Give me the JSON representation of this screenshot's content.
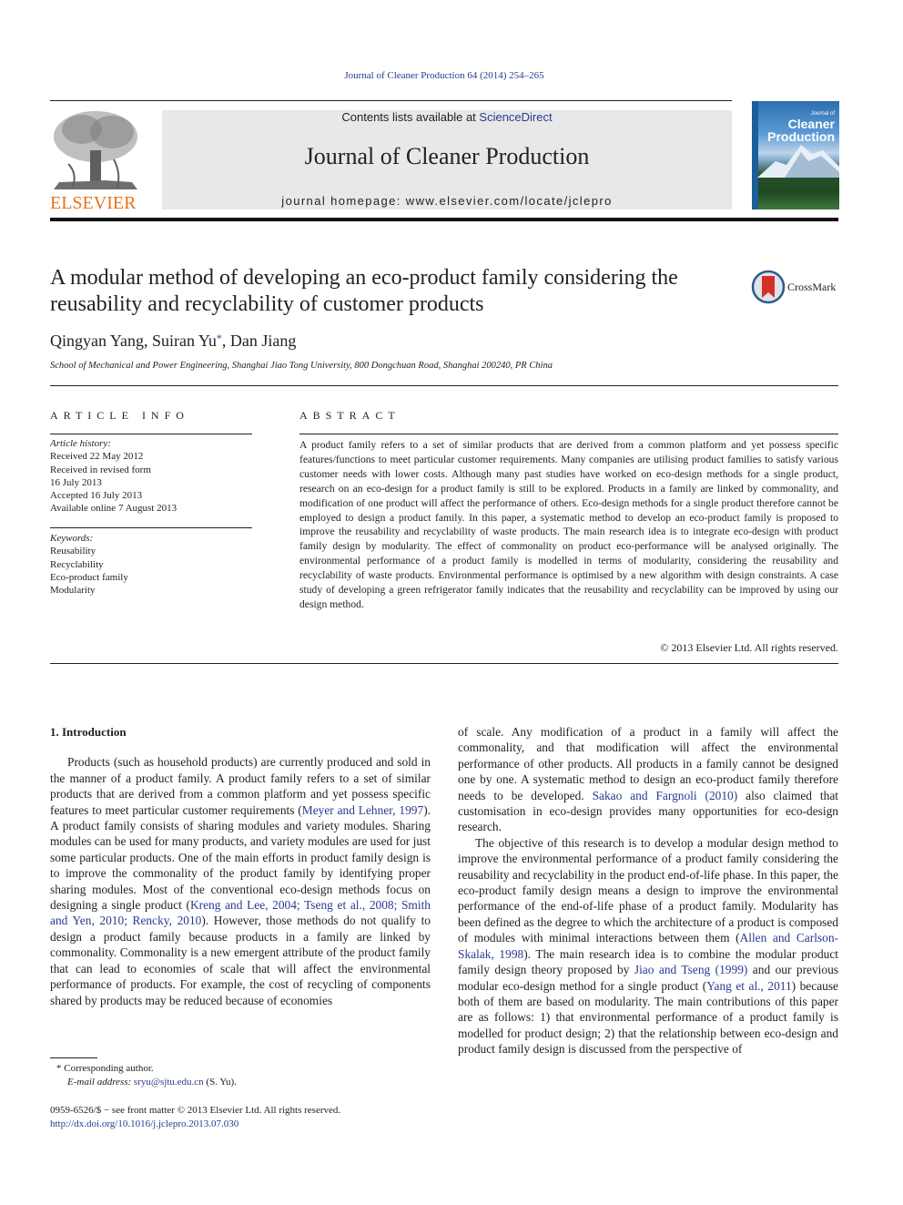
{
  "header": {
    "journal_ref": "Journal of Cleaner Production 64 (2014) 254–265",
    "publisher_logo_text": "ELSEVIER",
    "contents_prefix": "Contents lists available at ",
    "contents_link": "ScienceDirect",
    "journal_title": "Journal of Cleaner Production",
    "homepage": "journal homepage: www.elsevier.com/locate/jclepro",
    "cover": {
      "line1": "Journal of",
      "line2": "Cleaner",
      "line3": "Production"
    }
  },
  "colors": {
    "link": "#2a3a8f",
    "elsevier_orange": "#e9711c",
    "header_bg": "#e8e8e8"
  },
  "article": {
    "title": "A modular method of developing an eco-product family considering the reusability and recyclability of customer products",
    "crossmark_label": "CrossMark",
    "authors_part1": "Qingyan Yang, Suiran Yu",
    "authors_star": "*",
    "authors_part2": ", Dan Jiang",
    "affiliation": "School of Mechanical and Power Engineering, Shanghai Jiao Tong University, 800 Dongchuan Road, Shanghai 200240, PR China"
  },
  "article_info": {
    "label": "ARTICLE INFO",
    "history_label": "Article history:",
    "history": [
      "Received 22 May 2012",
      "Received in revised form",
      "16 July 2013",
      "Accepted 16 July 2013",
      "Available online 7 August 2013"
    ],
    "keywords_label": "Keywords:",
    "keywords": [
      "Reusability",
      "Recyclability",
      "Eco-product family",
      "Modularity"
    ]
  },
  "abstract": {
    "label": "ABSTRACT",
    "text": "A product family refers to a set of similar products that are derived from a common platform and yet possess specific features/functions to meet particular customer requirements. Many companies are utilising product families to satisfy various customer needs with lower costs. Although many past studies have worked on eco-design methods for a single product, research on an eco-design for a product family is still to be explored. Products in a family are linked by commonality, and modification of one product will affect the performance of others. Eco-design methods for a single product therefore cannot be employed to design a product family. In this paper, a systematic method to develop an eco-product family is proposed to improve the reusability and recyclability of waste products. The main research idea is to integrate eco-design with product family design by modularity. The effect of commonality on product eco-performance will be analysed originally. The environmental performance of a product family is modelled in terms of modularity, considering the reusability and recyclability of waste products. Environmental performance is optimised by a new algorithm with design constraints. A case study of developing a green refrigerator family indicates that the reusability and recyclability can be improved by using our design method.",
    "copyright": "© 2013 Elsevier Ltd. All rights reserved."
  },
  "body": {
    "section_heading": "1.  Introduction",
    "left": {
      "p1_a": "Products (such as household products) are currently produced and sold in the manner of a product family. A product family refers to a set of similar products that are derived from a common platform and yet possess specific features to meet particular customer requirements (",
      "p1_cite1": "Meyer and Lehner, 1997",
      "p1_b": "). A product family consists of sharing modules and variety modules. Sharing modules can be used for many products, and variety modules are used for just some particular products. One of the main efforts in product family design is to improve the commonality of the product family by identifying proper sharing modules. Most of the conventional eco-design methods focus on designing a single product (",
      "p1_cite2": "Kreng and Lee, 2004; Tseng et al., 2008; Smith and Yen, 2010; Rencky, 2010",
      "p1_c": "). However, those methods do not qualify to design a product family because products in a family are linked by commonality. Commonality is a new emergent attribute of the product family that can lead to economies of scale that will affect the environmental performance of products. For example, the cost of recycling of components shared by products may be reduced because of economies"
    },
    "right": {
      "p1_a": "of scale. Any modification of a product in a family will affect the commonality, and that modification will affect the environmental performance of other products. All products in a family cannot be designed one by one. A systematic method to design an eco-product family therefore needs to be developed. ",
      "p1_cite1": "Sakao and Fargnoli (2010)",
      "p1_b": " also claimed that customisation in eco-design provides many opportunities for eco-design research.",
      "p2_a": "The objective of this research is to develop a modular design method to improve the environmental performance of a product family considering the reusability and recyclability in the product end-of-life phase. In this paper, the eco-product family design means a design to improve the environmental performance of the end-of-life phase of a product family. Modularity has been defined as the degree to which the architecture of a product is composed of modules with minimal interactions between them (",
      "p2_cite1": "Allen and Carlson-Skalak, 1998",
      "p2_b": "). The main research idea is to combine the modular product family design theory proposed by ",
      "p2_cite2": "Jiao and Tseng (1999)",
      "p2_c": " and our previous modular eco-design method for a single product (",
      "p2_cite3": "Yang et al., 2011",
      "p2_d": ") because both of them are based on modularity. The main contributions of this paper are as follows: 1) that environmental performance of a product family is modelled for product design; 2) that the relationship between eco-design and product family design is discussed from the perspective of"
    }
  },
  "footnote": {
    "star_line": "*  Corresponding author.",
    "email_label": "E-mail address:",
    "email": "sryu@sjtu.edu.cn",
    "email_suffix": " (S. Yu)."
  },
  "front_matter": {
    "issn_line": "0959-6526/$ − see front matter © 2013 Elsevier Ltd. All rights reserved.",
    "doi": "http://dx.doi.org/10.1016/j.jclepro.2013.07.030"
  }
}
